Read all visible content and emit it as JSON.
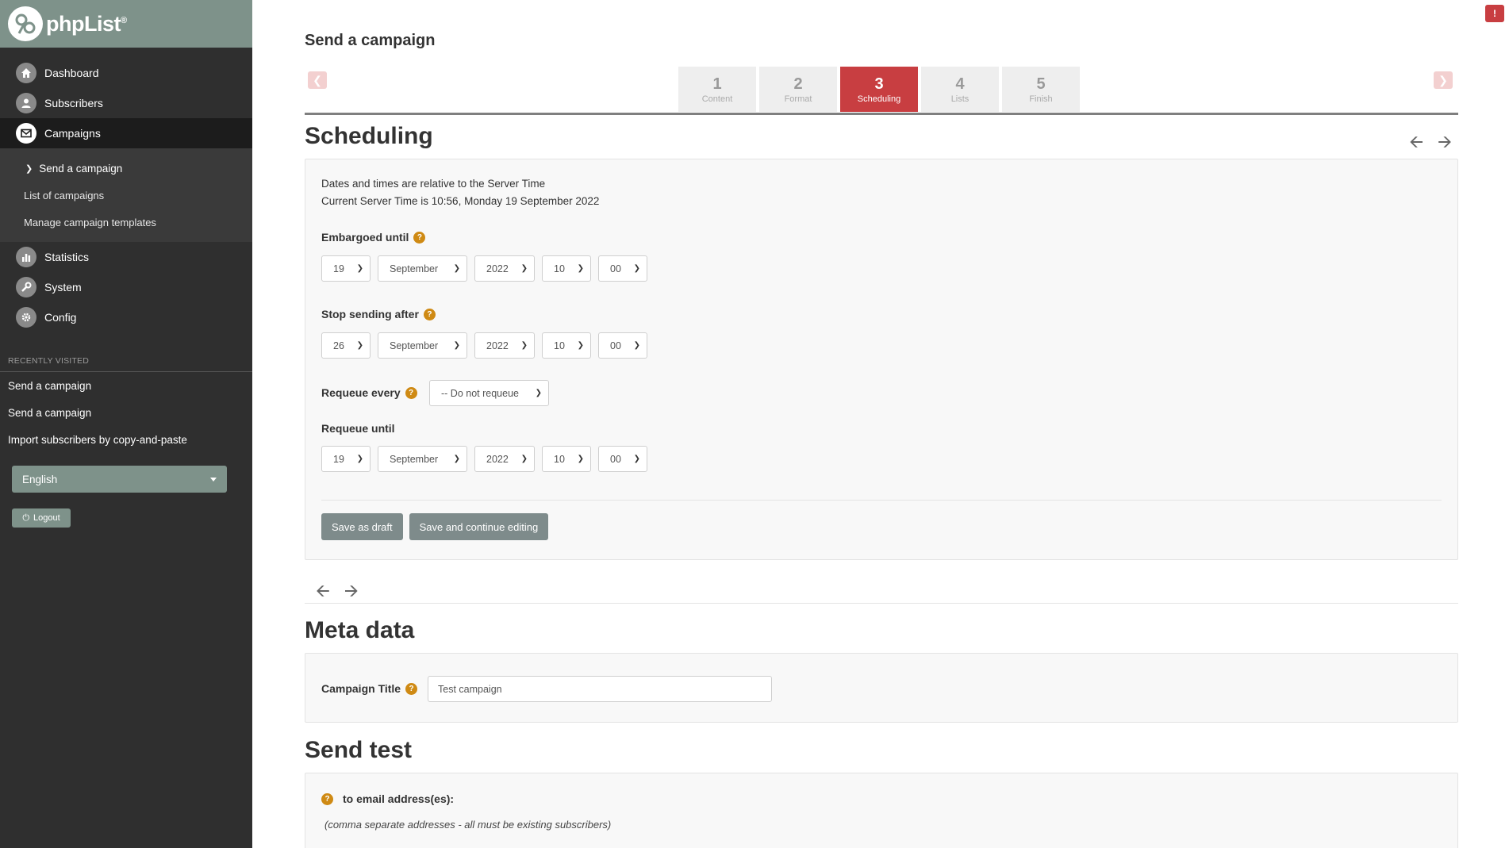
{
  "brand": {
    "name": "phpList",
    "mark": "®"
  },
  "sidebar": {
    "nav": [
      {
        "label": "Dashboard",
        "icon": "home-icon"
      },
      {
        "label": "Subscribers",
        "icon": "user-icon"
      },
      {
        "label": "Campaigns",
        "icon": "envelope-icon"
      },
      {
        "label": "Statistics",
        "icon": "bar-chart-icon"
      },
      {
        "label": "System",
        "icon": "wrench-icon"
      },
      {
        "label": "Config",
        "icon": "gear-icon"
      }
    ],
    "campaigns_sub": [
      {
        "label": "Send a campaign"
      },
      {
        "label": "List of campaigns"
      },
      {
        "label": "Manage campaign templates"
      }
    ],
    "recent_heading": "RECENTLY VISITED",
    "recent": [
      {
        "label": "Send a campaign"
      },
      {
        "label": "Send a campaign"
      },
      {
        "label": "Import subscribers by copy-and-paste"
      }
    ],
    "language": "English",
    "logout_label": "Logout"
  },
  "page": {
    "title": "Send a campaign"
  },
  "steps": [
    {
      "num": "1",
      "label": "Content"
    },
    {
      "num": "2",
      "label": "Format"
    },
    {
      "num": "3",
      "label": "Scheduling"
    },
    {
      "num": "4",
      "label": "Lists"
    },
    {
      "num": "5",
      "label": "Finish"
    }
  ],
  "active_step": 3,
  "scheduling": {
    "title": "Scheduling",
    "info_line1": "Dates and times are relative to the Server Time",
    "info_line2": "Current Server Time is 10:56, Monday 19 September 2022",
    "embargo": {
      "label": "Embargoed until",
      "day": "19",
      "month": "September",
      "year": "2022",
      "hour": "10",
      "minute": "00"
    },
    "stop": {
      "label": "Stop sending after",
      "day": "26",
      "month": "September",
      "year": "2022",
      "hour": "10",
      "minute": "00"
    },
    "requeue_every": {
      "label": "Requeue every",
      "value": "-- Do not requeue"
    },
    "requeue_until": {
      "label": "Requeue until",
      "day": "19",
      "month": "September",
      "year": "2022",
      "hour": "10",
      "minute": "00"
    },
    "save_draft_label": "Save as draft",
    "save_continue_label": "Save and continue editing"
  },
  "meta": {
    "title": "Meta data",
    "campaign_title_label": "Campaign Title",
    "campaign_title_value": "Test campaign"
  },
  "send_test": {
    "title": "Send test",
    "to_label": "to email address(es):",
    "hint": "(comma separate addresses - all must be existing subscribers)"
  },
  "colors": {
    "accent": "#c83e41",
    "sidebar": "#2f2f2f",
    "logo_bar": "#7e928a",
    "help": "#cf8a14"
  }
}
